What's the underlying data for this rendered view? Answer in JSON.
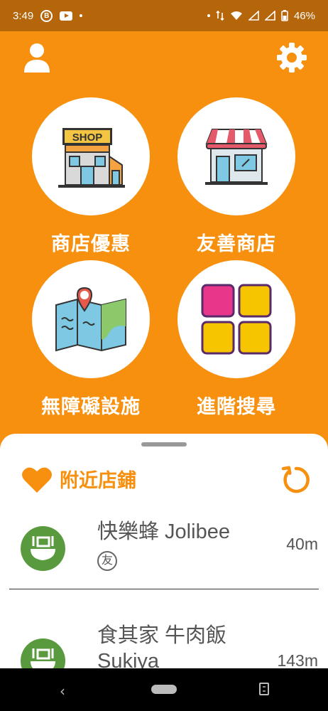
{
  "status_bar": {
    "time": "3:49",
    "battery": "46%",
    "badge_letter": "B"
  },
  "top_bar": {
    "profile_icon": "person-icon",
    "settings_icon": "gear-icon"
  },
  "tiles": [
    {
      "label": "商店優惠",
      "icon": "shop-icon"
    },
    {
      "label": "友善商店",
      "icon": "storefront-icon"
    },
    {
      "label": "無障礙設施",
      "icon": "accessibility-map-icon"
    },
    {
      "label": "進階搜尋",
      "icon": "grid-icon"
    }
  ],
  "nearby": {
    "title": "附近店鋪",
    "stores": [
      {
        "name": "快樂蜂 Jolibee",
        "badge": "友",
        "distance": "40m"
      },
      {
        "name": "食其家 牛肉飯 Sukiya",
        "distance": "143m"
      }
    ]
  },
  "colors": {
    "accent": "#F7900F",
    "status_bar": "#B5650A",
    "store_icon": "#5A9A3E"
  }
}
